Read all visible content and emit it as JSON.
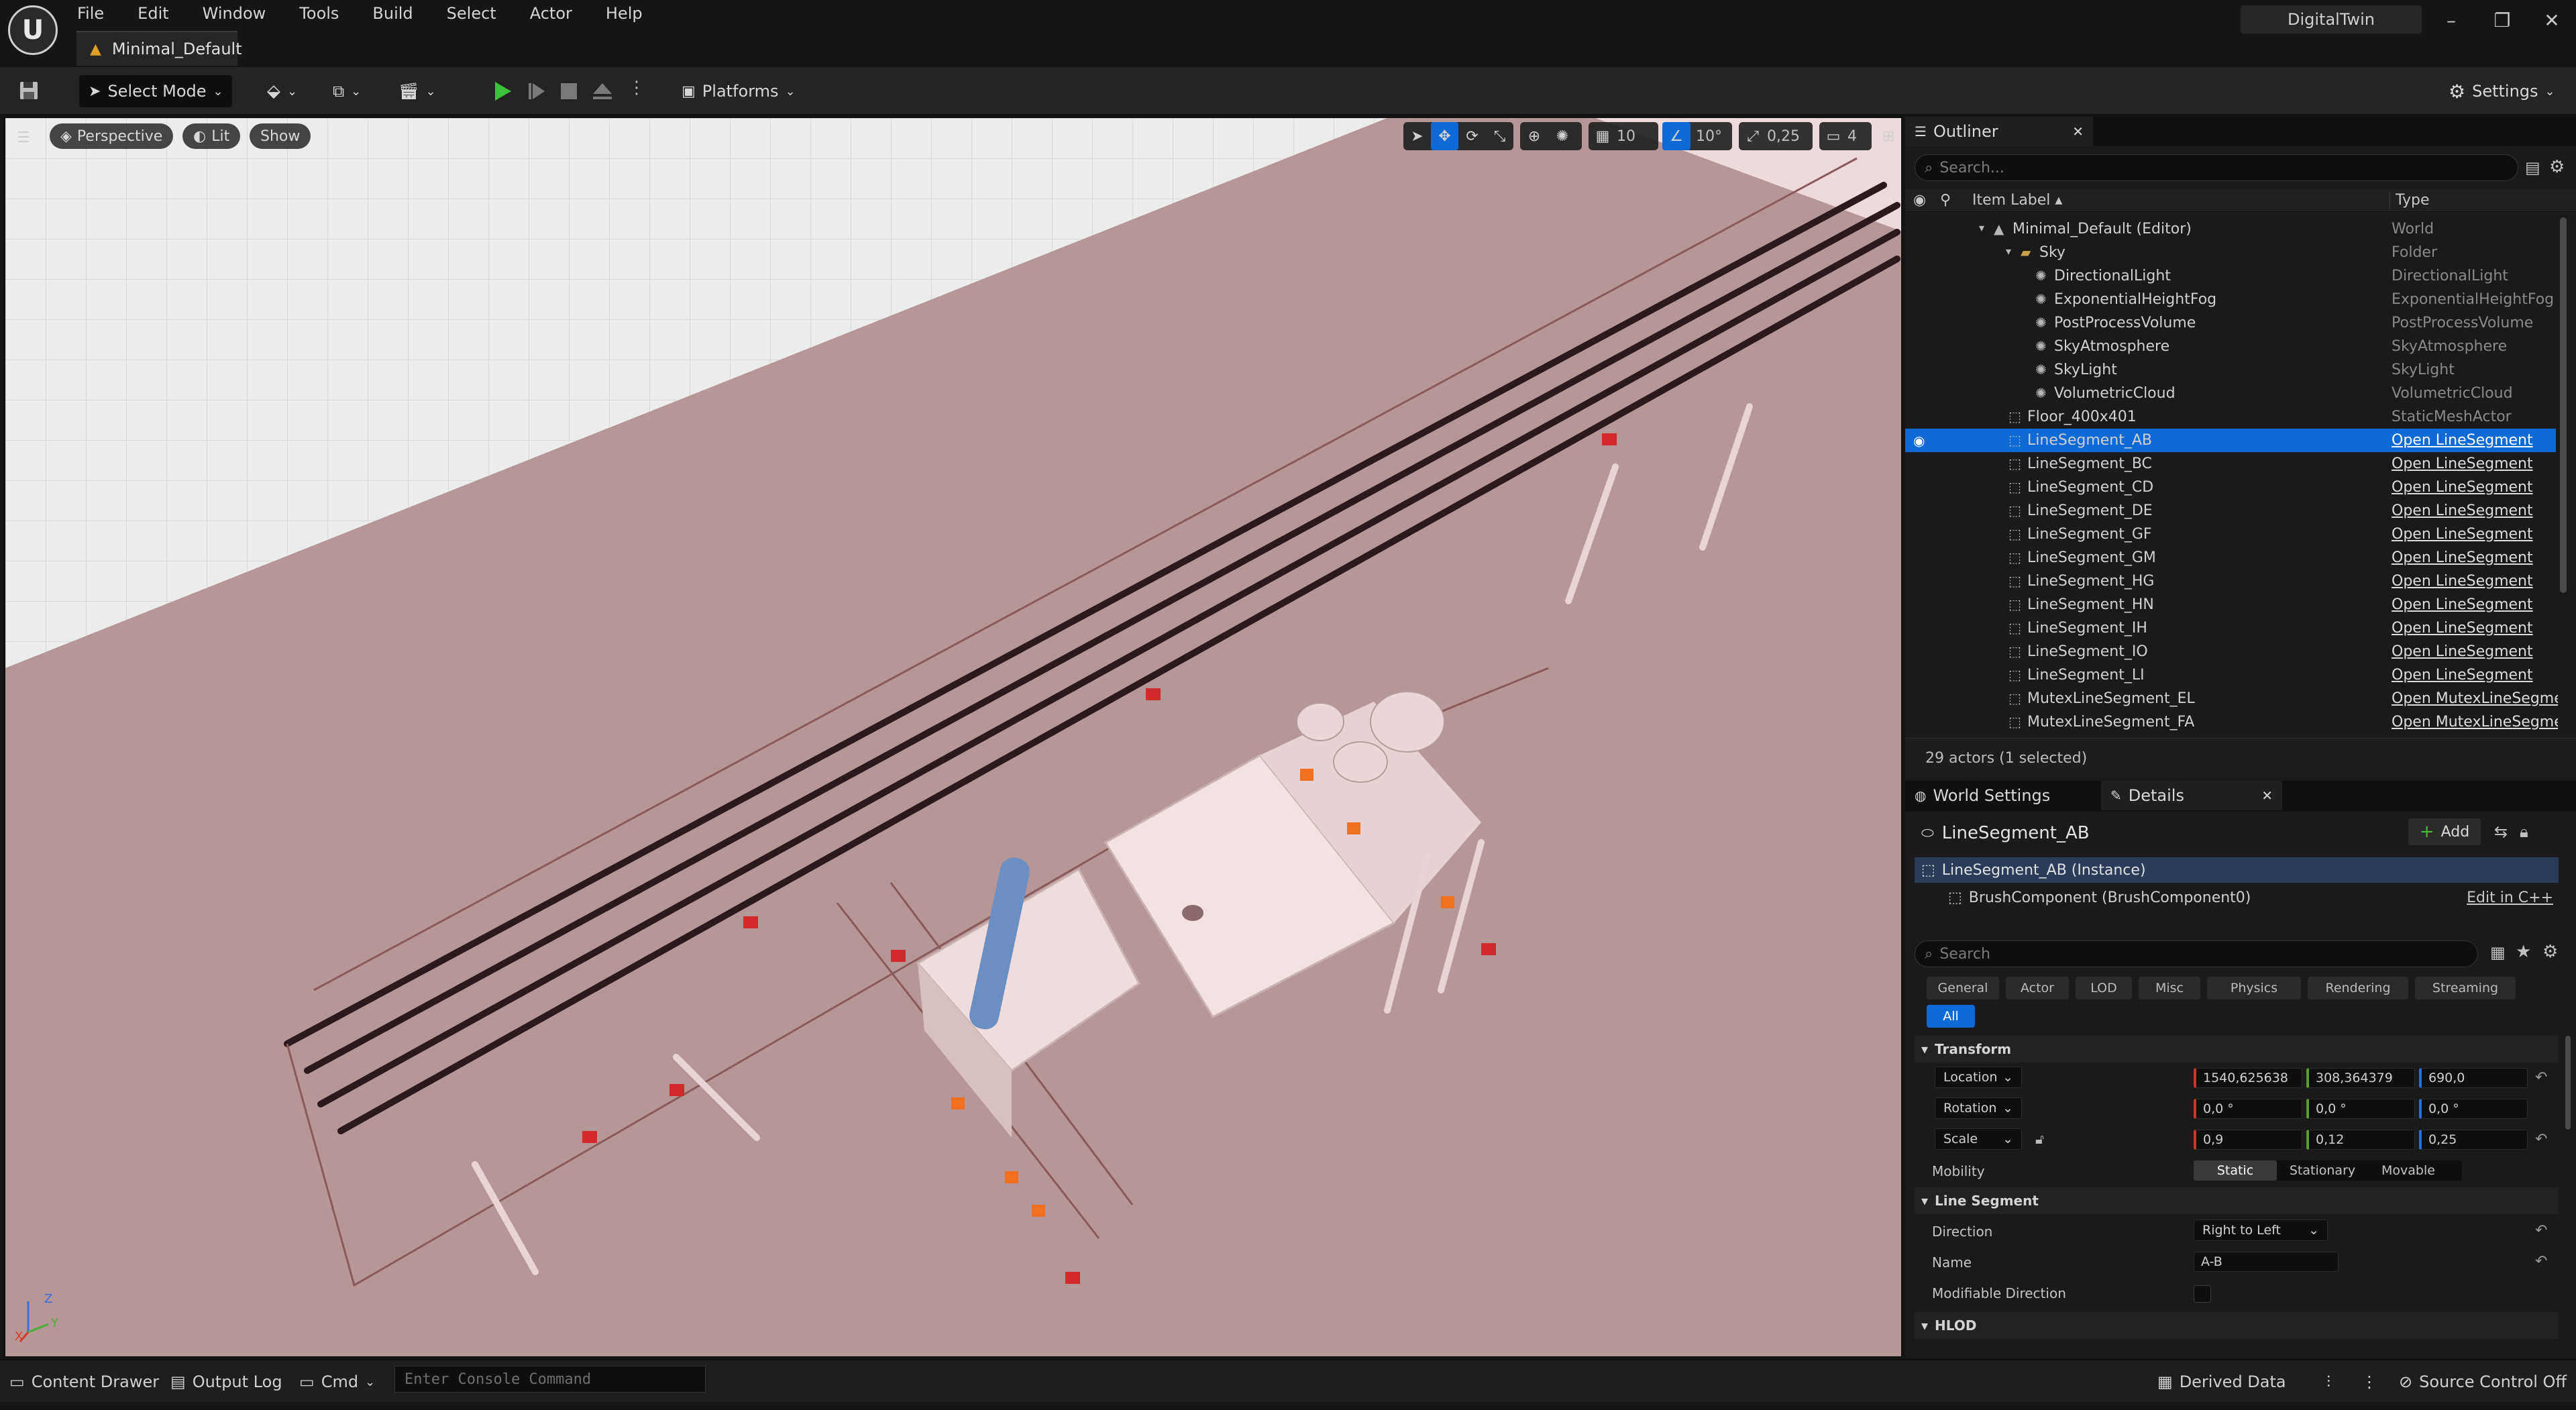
{
  "app": {
    "project_name": "DigitalTwin",
    "level_tab": "Minimal_Default",
    "menu": [
      "File",
      "Edit",
      "Window",
      "Tools",
      "Build",
      "Select",
      "Actor",
      "Help"
    ]
  },
  "toolbar": {
    "select_mode": "Select Mode",
    "platforms": "Platforms",
    "settings": "Settings"
  },
  "viewport": {
    "perspective": "Perspective",
    "lit": "Lit",
    "show": "Show",
    "grid_snap": "10",
    "rotation_snap": "10°",
    "scale_snap": "0,25",
    "camera_speed": "4",
    "axis_z": "Z",
    "axis_y": "Y",
    "axis_x": "X"
  },
  "outliner": {
    "title": "Outliner",
    "search_placeholder": "Search...",
    "col_label": "Item Label",
    "col_type": "Type",
    "items": [
      {
        "label": "Minimal_Default (Editor)",
        "type": "World",
        "link": false
      },
      {
        "label": "Sky",
        "type": "Folder",
        "link": false
      },
      {
        "label": "DirectionalLight",
        "type": "DirectionalLight",
        "link": false
      },
      {
        "label": "ExponentialHeightFog",
        "type": "ExponentialHeightFog",
        "link": false
      },
      {
        "label": "PostProcessVolume",
        "type": "PostProcessVolume",
        "link": false
      },
      {
        "label": "SkyAtmosphere",
        "type": "SkyAtmosphere",
        "link": false
      },
      {
        "label": "SkyLight",
        "type": "SkyLight",
        "link": false
      },
      {
        "label": "VolumetricCloud",
        "type": "VolumetricCloud",
        "link": false
      },
      {
        "label": "Floor_400x401",
        "type": "StaticMeshActor",
        "link": false
      },
      {
        "label": "LineSegment_AB",
        "type": "Open LineSegment",
        "link": true
      },
      {
        "label": "LineSegment_BC",
        "type": "Open LineSegment",
        "link": true
      },
      {
        "label": "LineSegment_CD",
        "type": "Open LineSegment",
        "link": true
      },
      {
        "label": "LineSegment_DE",
        "type": "Open LineSegment",
        "link": true
      },
      {
        "label": "LineSegment_GF",
        "type": "Open LineSegment",
        "link": true
      },
      {
        "label": "LineSegment_GM",
        "type": "Open LineSegment",
        "link": true
      },
      {
        "label": "LineSegment_HG",
        "type": "Open LineSegment",
        "link": true
      },
      {
        "label": "LineSegment_HN",
        "type": "Open LineSegment",
        "link": true
      },
      {
        "label": "LineSegment_IH",
        "type": "Open LineSegment",
        "link": true
      },
      {
        "label": "LineSegment_IO",
        "type": "Open LineSegment",
        "link": true
      },
      {
        "label": "LineSegment_LI",
        "type": "Open LineSegment",
        "link": true
      },
      {
        "label": "MutexLineSegment_EL",
        "type": "Open MutexLineSegme",
        "link": true
      },
      {
        "label": "MutexLineSegment_FA",
        "type": "Open MutexLineSegme",
        "link": true
      }
    ],
    "actor_count": "29 actors (1 selected)"
  },
  "details": {
    "tab_world_settings": "World Settings",
    "tab_details": "Details",
    "actor_name": "LineSegment_AB",
    "add_label": "Add",
    "instance_label": "LineSegment_AB (Instance)",
    "component_label": "BrushComponent (BrushComponent0)",
    "edit_cpp": "Edit in C++",
    "search_placeholder": "Search",
    "filters": [
      "General",
      "Actor",
      "LOD",
      "Misc",
      "Physics",
      "Rendering",
      "Streaming",
      "All"
    ],
    "transform": {
      "section": "Transform",
      "location_label": "Location",
      "location": [
        "1540,625638",
        "308,364379",
        "690,0"
      ],
      "rotation_label": "Rotation",
      "rotation": [
        "0,0 °",
        "0,0 °",
        "0,0 °"
      ],
      "scale_label": "Scale",
      "scale": [
        "0,9",
        "0,12",
        "0,25"
      ],
      "mobility_label": "Mobility",
      "mobility_options": [
        "Static",
        "Stationary",
        "Movable"
      ]
    },
    "line_segment": {
      "section": "Line Segment",
      "direction_label": "Direction",
      "direction_value": "Right to Left",
      "name_label": "Name",
      "name_value": "A-B",
      "modifiable_label": "Modifiable Direction"
    },
    "hlod_section": "HLOD"
  },
  "statusbar": {
    "content_drawer": "Content Drawer",
    "output_log": "Output Log",
    "cmd": "Cmd",
    "console_placeholder": "Enter Console Command",
    "derived_data": "Derived Data",
    "source_control": "Source Control Off"
  },
  "colors": {
    "selection_blue": "#0e6ad6",
    "play_green": "#3fbf3f",
    "floor_pink": "#b89898"
  }
}
